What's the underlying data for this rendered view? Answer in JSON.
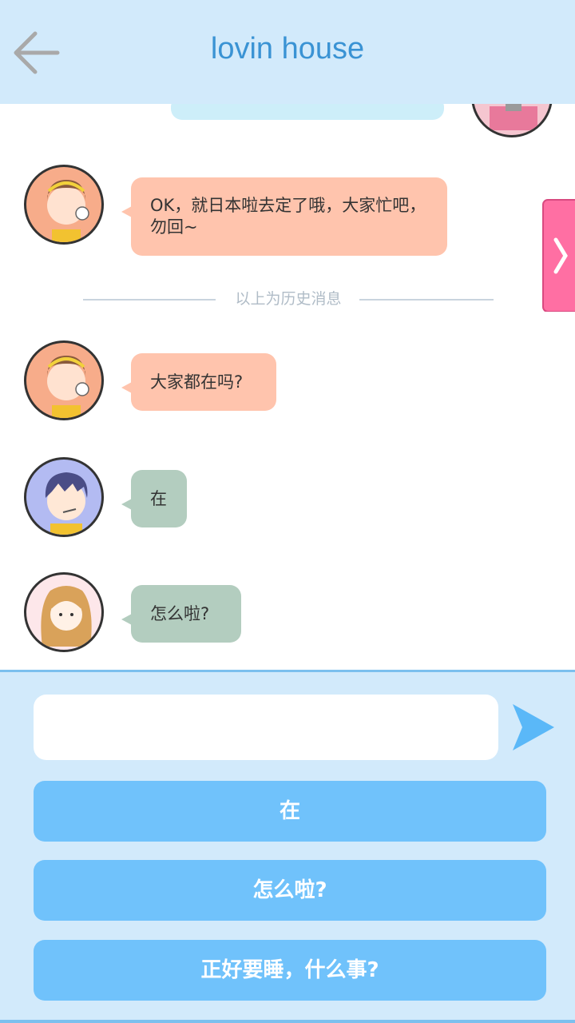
{
  "header": {
    "title": "lovin house"
  },
  "chat": {
    "messages": [
      {
        "text": "OK，就日本啦去定了哦，大家忙吧，勿回~",
        "avatar": "girl-bangs",
        "color": "#ffc4ad"
      },
      {
        "text": "大家都在吗?",
        "avatar": "girl-bangs",
        "color": "#ffc4ad"
      },
      {
        "text": "在",
        "avatar": "boy-messy-hair",
        "color": "#b3cdbf"
      },
      {
        "text": "怎么啦?",
        "avatar": "girl-wavy-hair",
        "color": "#b3cdbf"
      }
    ],
    "divider_text": "以上为历史消息"
  },
  "input": {
    "placeholder": "",
    "value": ""
  },
  "choices": [
    {
      "label": "在"
    },
    {
      "label": "怎么啦?"
    },
    {
      "label": "正好要睡，什么事?"
    }
  ],
  "colors": {
    "header_bg": "#d2eafb",
    "title": "#3a93d4",
    "choice_bg": "#70c2fb",
    "send": "#5ab8f8"
  }
}
